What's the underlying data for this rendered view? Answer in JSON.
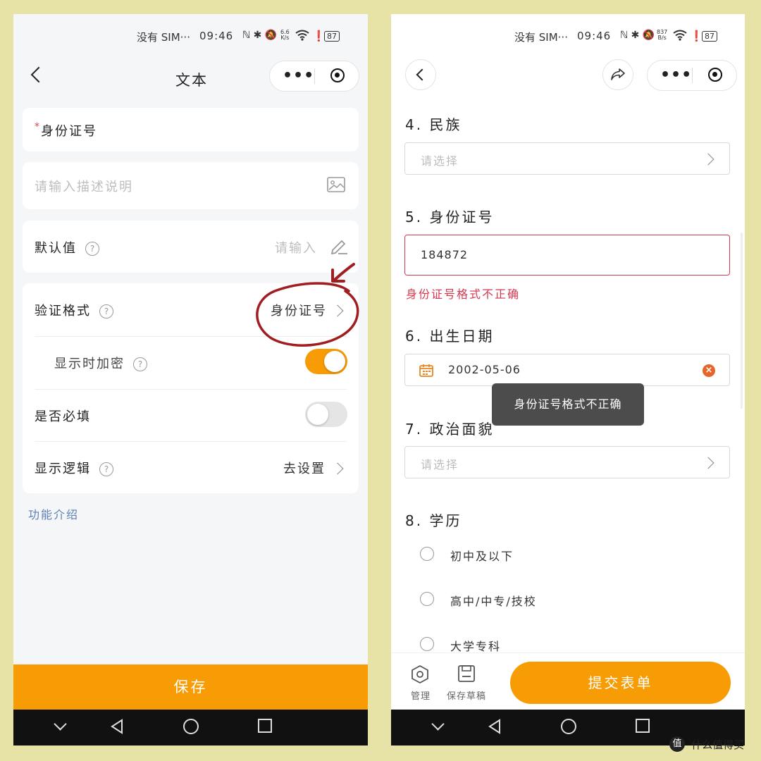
{
  "colors": {
    "background": "#e7e3a6",
    "accent": "#f79c05",
    "error": "#d9364e",
    "annotation": "#a01e22",
    "link": "#5b7fb3",
    "toast_bg": "#4c4c4c"
  },
  "status_bar": {
    "carrier": "没有 SIM···",
    "time": "09:46",
    "battery": "87",
    "left_speed_value": "6.6",
    "left_speed_unit": "K/s",
    "right_speed_value": "837",
    "right_speed_unit": "B/s"
  },
  "left": {
    "nav": {
      "title": "文本",
      "menu_dots": "•••"
    },
    "field_name": {
      "required_mark": "*",
      "label": "身份证号"
    },
    "description": {
      "placeholder": "请输入描述说明",
      "icon": "image-icon"
    },
    "default_value": {
      "label": "默认值",
      "placeholder": "请输入",
      "icon": "edit-pencil-icon"
    },
    "validation": {
      "label": "验证格式",
      "value": "身份证号"
    },
    "encrypt": {
      "label": "显示时加密",
      "enabled": true
    },
    "required": {
      "label": "是否必填",
      "enabled": false
    },
    "logic": {
      "label": "显示逻辑",
      "value": "去设置"
    },
    "help_glyph": "?",
    "feature_link": "功能介绍",
    "save_button": "保存"
  },
  "right": {
    "nav": {
      "menu_dots": "•••",
      "share_icon": "share-icon"
    },
    "q4": {
      "title": "4. 民族",
      "placeholder": "请选择"
    },
    "q5": {
      "title": "5. 身份证号",
      "value": "184872",
      "error": "身份证号格式不正确"
    },
    "q6": {
      "title": "6. 出生日期",
      "value": "2002-05-06"
    },
    "q7": {
      "title": "7. 政治面貌",
      "placeholder": "请选择"
    },
    "q8": {
      "title": "8. 学历",
      "options": [
        "初中及以下",
        "高中/中专/技校",
        "大学专科"
      ]
    },
    "toast": "身份证号格式不正确",
    "bottom": {
      "manage": "管理",
      "save_draft": "保存草稿",
      "submit": "提交表单"
    }
  },
  "watermark": {
    "symbol": "值",
    "text": "什么值得买"
  }
}
